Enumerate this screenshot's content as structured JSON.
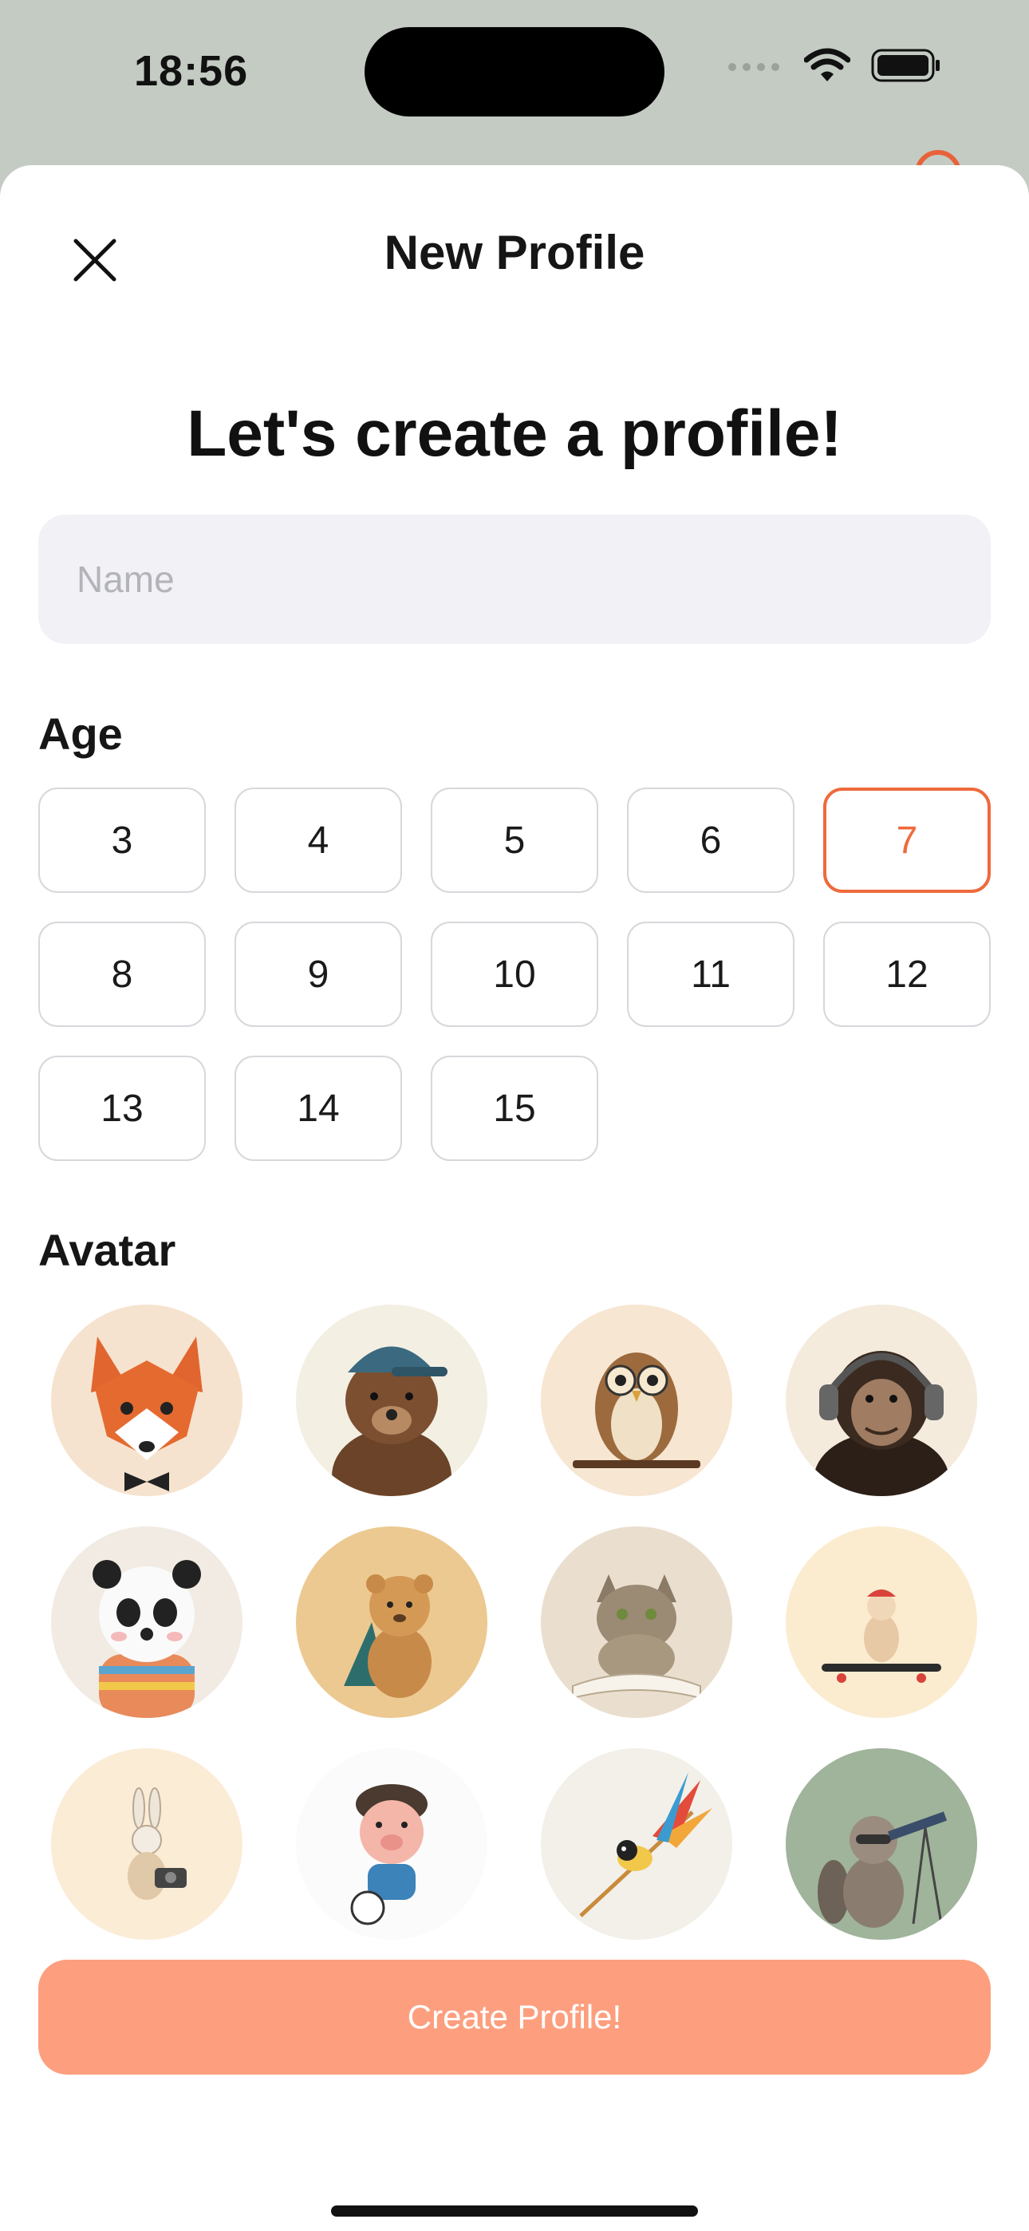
{
  "status_bar": {
    "time": "18:56"
  },
  "nav": {
    "title": "New Profile"
  },
  "headline": "Let's create a profile!",
  "name_field": {
    "placeholder": "Name",
    "value": ""
  },
  "age": {
    "label": "Age",
    "options": [
      "3",
      "4",
      "5",
      "6",
      "7",
      "8",
      "9",
      "10",
      "11",
      "12",
      "13",
      "14",
      "15"
    ],
    "selected": "7"
  },
  "avatar": {
    "label": "Avatar",
    "items": [
      {
        "name": "fox-avatar"
      },
      {
        "name": "bear-avatar"
      },
      {
        "name": "owl-avatar"
      },
      {
        "name": "chimpanzee-avatar"
      },
      {
        "name": "panda-avatar"
      },
      {
        "name": "lion-cub-avatar"
      },
      {
        "name": "cat-avatar"
      },
      {
        "name": "bulldog-avatar"
      },
      {
        "name": "rabbit-avatar"
      },
      {
        "name": "piglet-avatar"
      },
      {
        "name": "bird-avatar"
      },
      {
        "name": "raccoon-avatar"
      }
    ]
  },
  "create_button": {
    "label": "Create Profile!"
  },
  "colors": {
    "accent": "#ee6a3c",
    "button": "#fd9f7e",
    "input_bg": "#f1f1f6",
    "sheet_bg": "#ffffff"
  }
}
